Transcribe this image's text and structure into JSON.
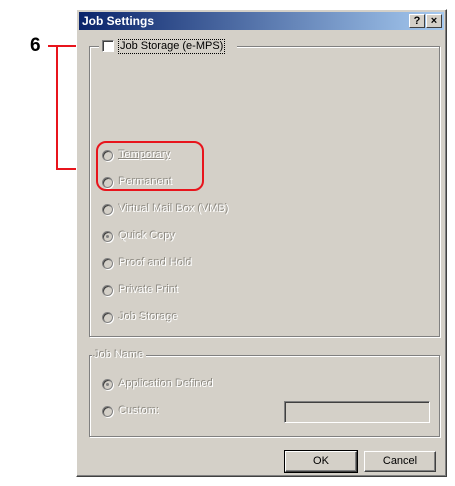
{
  "callout": {
    "number": "6",
    "color": "#e8141c"
  },
  "window": {
    "title": "Job Settings",
    "help_button": "?",
    "close_button": "×"
  },
  "job_storage_checkbox": {
    "label": "Job Storage (e-MPS)",
    "checked": false
  },
  "storage_options": [
    {
      "label": "Temporary",
      "checked": false
    },
    {
      "label": "Permanent",
      "checked": false
    },
    {
      "label": "Virtual Mail Box (VMB)",
      "checked": false
    },
    {
      "label": "Quick Copy",
      "checked": true
    },
    {
      "label": "Proof and Hold",
      "checked": false
    },
    {
      "label": "Private Print",
      "checked": false
    },
    {
      "label": "Job Storage",
      "checked": false
    }
  ],
  "job_name": {
    "group_label": "Job Name",
    "options": [
      {
        "label": "Application Defined",
        "checked": true
      },
      {
        "label": "Custom:",
        "checked": false
      }
    ],
    "custom_value": ""
  },
  "buttons": {
    "ok": "OK",
    "cancel": "Cancel"
  }
}
